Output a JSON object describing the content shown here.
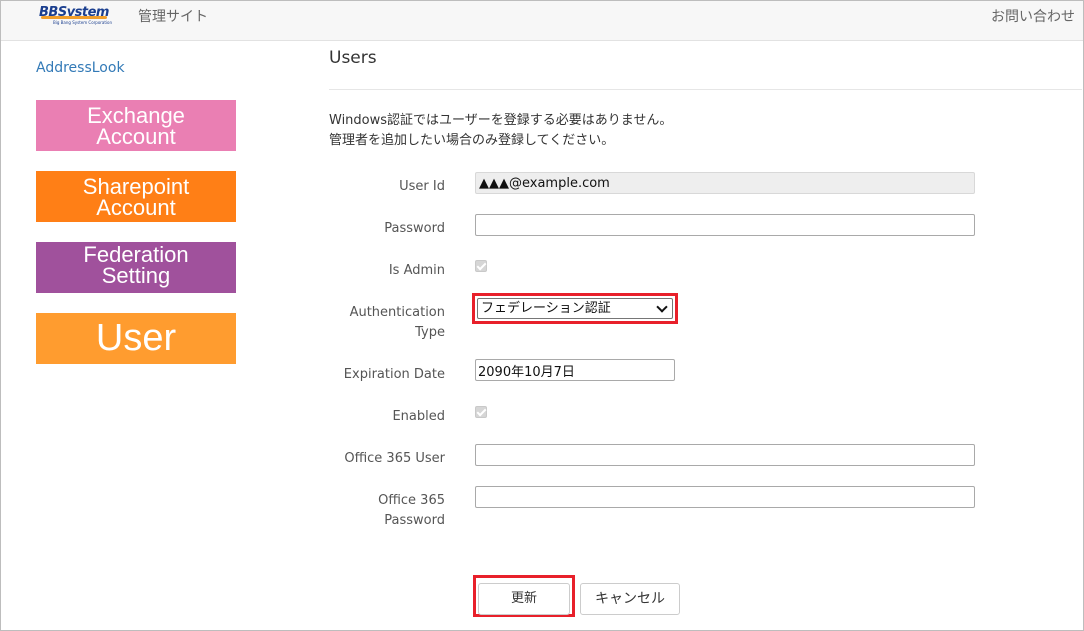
{
  "header": {
    "logo_text": "BBSystem",
    "logo_subtext": "Big Bang System Corporation",
    "site_name": "管理サイト",
    "contact_link": "お問い合わせ"
  },
  "sidebar": {
    "app_link": "AddressLook",
    "tiles": [
      {
        "line1": "Exchange",
        "line2": "Account",
        "color": "#ea7fb3"
      },
      {
        "line1": "Sharepoint",
        "line2": "Account",
        "color": "#ff7f16"
      },
      {
        "line1": "Federation",
        "line2": "Setting",
        "color": "#a0519c"
      },
      {
        "line1": "User",
        "line2": "",
        "color": "#ff9c2f"
      }
    ]
  },
  "main": {
    "title": "Users",
    "notice_line1": "Windows認証ではユーザーを登録する必要はありません。",
    "notice_line2": "管理者を追加したい場合のみ登録してください。"
  },
  "form": {
    "user_id_label": "User Id",
    "user_id_value": "▲▲▲@example.com",
    "password_label": "Password",
    "password_value": "",
    "is_admin_label": "Is Admin",
    "is_admin_checked": true,
    "auth_type_label_line1": "Authentication",
    "auth_type_label_line2": "Type",
    "auth_type_value": "フェデレーション認証",
    "expiration_label": "Expiration Date",
    "expiration_value": "2090年10月7日",
    "enabled_label": "Enabled",
    "enabled_checked": true,
    "o365_user_label": "Office 365 User",
    "o365_user_value": "",
    "o365_password_label_line1": "Office 365",
    "o365_password_label_line2": "Password",
    "o365_password_value": ""
  },
  "actions": {
    "update_label": "更新",
    "cancel_label": "キャンセル"
  },
  "colors": {
    "highlight": "#e8202a",
    "link": "#337ab7"
  }
}
